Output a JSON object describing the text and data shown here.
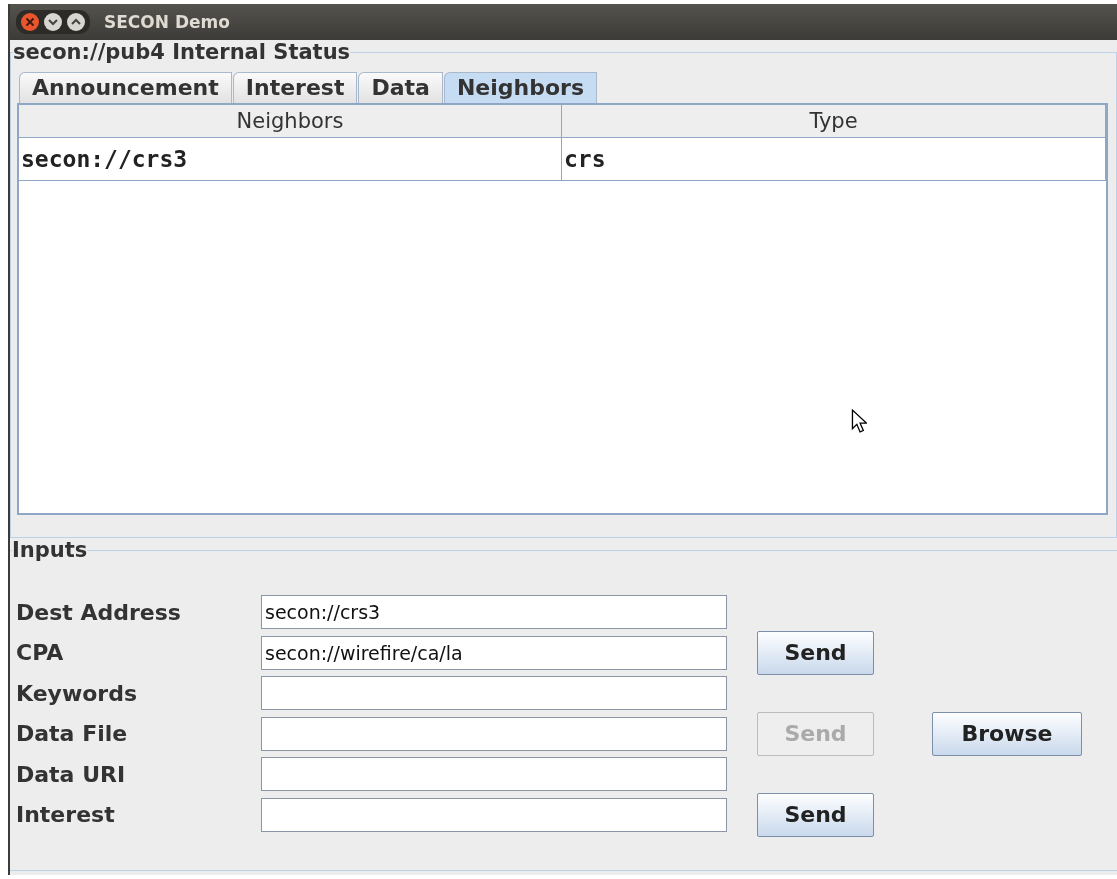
{
  "window": {
    "title": "SECON Demo"
  },
  "status_group": {
    "title": "secon://pub4 Internal Status",
    "tabs": [
      {
        "label": "Announcement",
        "selected": false
      },
      {
        "label": "Interest",
        "selected": false
      },
      {
        "label": "Data",
        "selected": false
      },
      {
        "label": "Neighbors",
        "selected": true
      }
    ],
    "table": {
      "columns": [
        "Neighbors",
        "Type"
      ],
      "rows": [
        [
          "secon://crs3",
          "crs"
        ]
      ]
    }
  },
  "inputs": {
    "title": "Inputs",
    "rows": [
      {
        "label": "Dest Address",
        "value": "secon://crs3"
      },
      {
        "label": "CPA",
        "value": "secon://wirefire/ca/la",
        "send": {
          "label": "Send",
          "disabled": false
        }
      },
      {
        "label": "Keywords",
        "value": ""
      },
      {
        "label": "Data File",
        "value": "",
        "send": {
          "label": "Send",
          "disabled": true
        },
        "extra": {
          "label": "Browse",
          "disabled": false
        }
      },
      {
        "label": "Data URI",
        "value": ""
      },
      {
        "label": "Interest",
        "value": "",
        "send": {
          "label": "Send",
          "disabled": false
        }
      }
    ]
  }
}
